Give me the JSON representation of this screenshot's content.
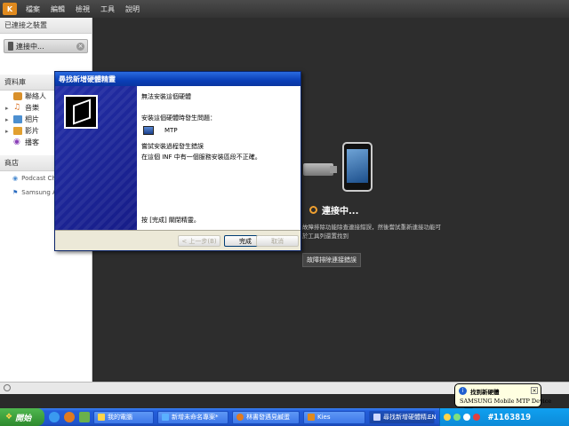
{
  "app": {
    "menu": [
      "檔案",
      "編輯",
      "檢視",
      "工具",
      "說明"
    ],
    "sidebar": {
      "connected_header": "已連接之裝置",
      "connected_device": "連接中...",
      "library_header": "資料庫",
      "library_items": [
        {
          "label": "聯絡人",
          "icon": "contacts-icon",
          "expandable": false
        },
        {
          "label": "音樂",
          "icon": "music-icon",
          "expandable": true
        },
        {
          "label": "相片",
          "icon": "photo-icon",
          "expandable": true
        },
        {
          "label": "影片",
          "icon": "video-icon",
          "expandable": true
        },
        {
          "label": "播客",
          "icon": "podcast-icon",
          "expandable": false
        }
      ],
      "store_header": "商店",
      "store_items": [
        "Podcast Ch",
        "Samsung A"
      ]
    },
    "main": {
      "status": "連接中...",
      "fail_text": "故障排除功能除查連接錯誤，然後嘗試重新連接功能可於工具列還置找到",
      "trouble_button": "故障排除連接錯誤"
    }
  },
  "wizard": {
    "title": "尋找新增硬體精靈",
    "line1": "無法安裝這個硬體",
    "line2": "安裝這個硬體時發生問題：",
    "device": "MTP",
    "line3": "嘗試安裝過程發生錯誤",
    "line4": "在這個 INF 中有一個服務安裝區段不正確。",
    "finish_note": "按 [完成] 關閉精靈。",
    "back_button": "< 上一步(B)",
    "finish_button": "完成",
    "cancel_button": "取消"
  },
  "taskbar": {
    "start": "開始",
    "tasks": [
      {
        "label": "我的電腦",
        "active": false
      },
      {
        "label": "新增未命名專案*",
        "active": false
      },
      {
        "label": "林書發遇見鹹蛋",
        "active": false
      },
      {
        "label": "Kies",
        "active": false
      },
      {
        "label": "尋找新增硬體精...",
        "active": true
      }
    ],
    "lang": "EN",
    "clock": "#1163819"
  },
  "balloon": {
    "title": "找到新硬體",
    "text": "SAMSUNG Mobile MTP Device"
  },
  "colors": {
    "accent": "#e08a1e",
    "xp_blue": "#0a3fb8"
  }
}
